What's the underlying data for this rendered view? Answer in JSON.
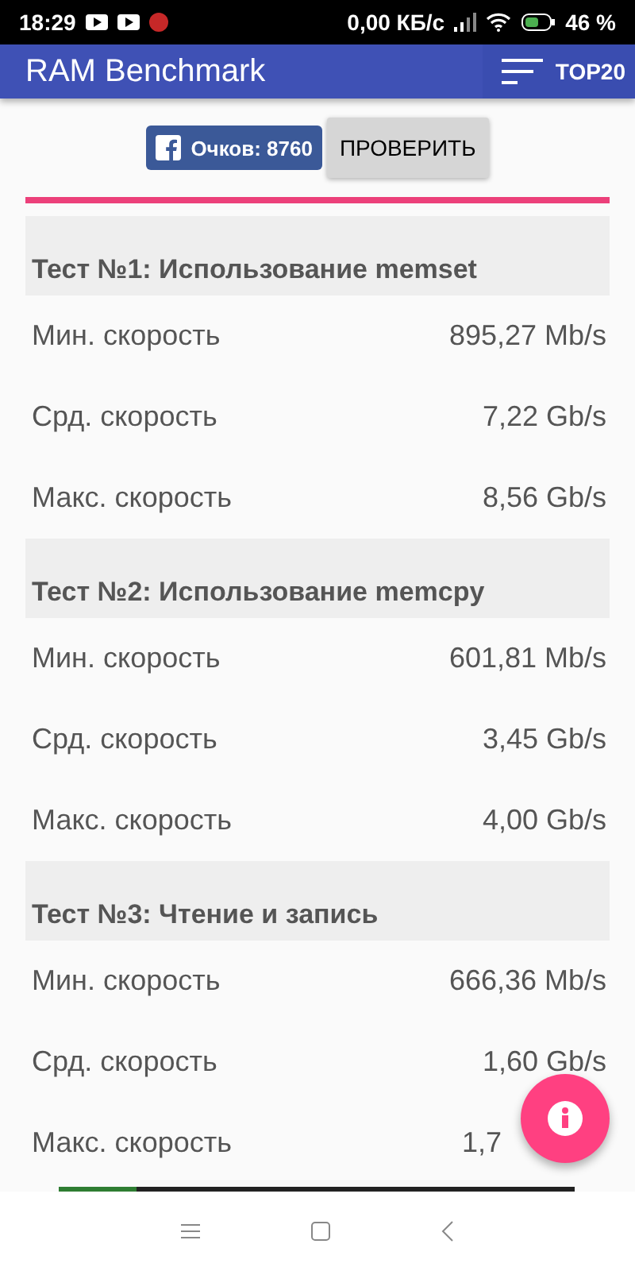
{
  "status_bar": {
    "time": "18:29",
    "speed": "0,00 КБ/с",
    "battery": "46 %"
  },
  "app_bar": {
    "title": "RAM Benchmark",
    "action": "TOP20"
  },
  "score_button": "Очков: 8760",
  "check_button": "ПРОВЕРИТЬ",
  "tests": [
    {
      "title": "Тест №1: Использование memset",
      "rows": [
        {
          "label": "Мин. скорость",
          "value": "895,27 Mb/s"
        },
        {
          "label": "Срд. скорость",
          "value": "7,22 Gb/s"
        },
        {
          "label": "Макс. скорость",
          "value": "8,56 Gb/s"
        }
      ]
    },
    {
      "title": "Тест №2: Использование memcpy",
      "rows": [
        {
          "label": "Мин. скорость",
          "value": "601,81 Mb/s"
        },
        {
          "label": "Срд. скорость",
          "value": "3,45 Gb/s"
        },
        {
          "label": "Макс. скорость",
          "value": "4,00 Gb/s"
        }
      ]
    },
    {
      "title": "Тест №3: Чтение и запись",
      "rows": [
        {
          "label": "Мин. скорость",
          "value": "666,36 Mb/s"
        },
        {
          "label": "Срд. скорость",
          "value": "1,60 Gb/s"
        },
        {
          "label": "Макс. скорость",
          "value": "1,7",
          "covered": true
        }
      ]
    }
  ]
}
